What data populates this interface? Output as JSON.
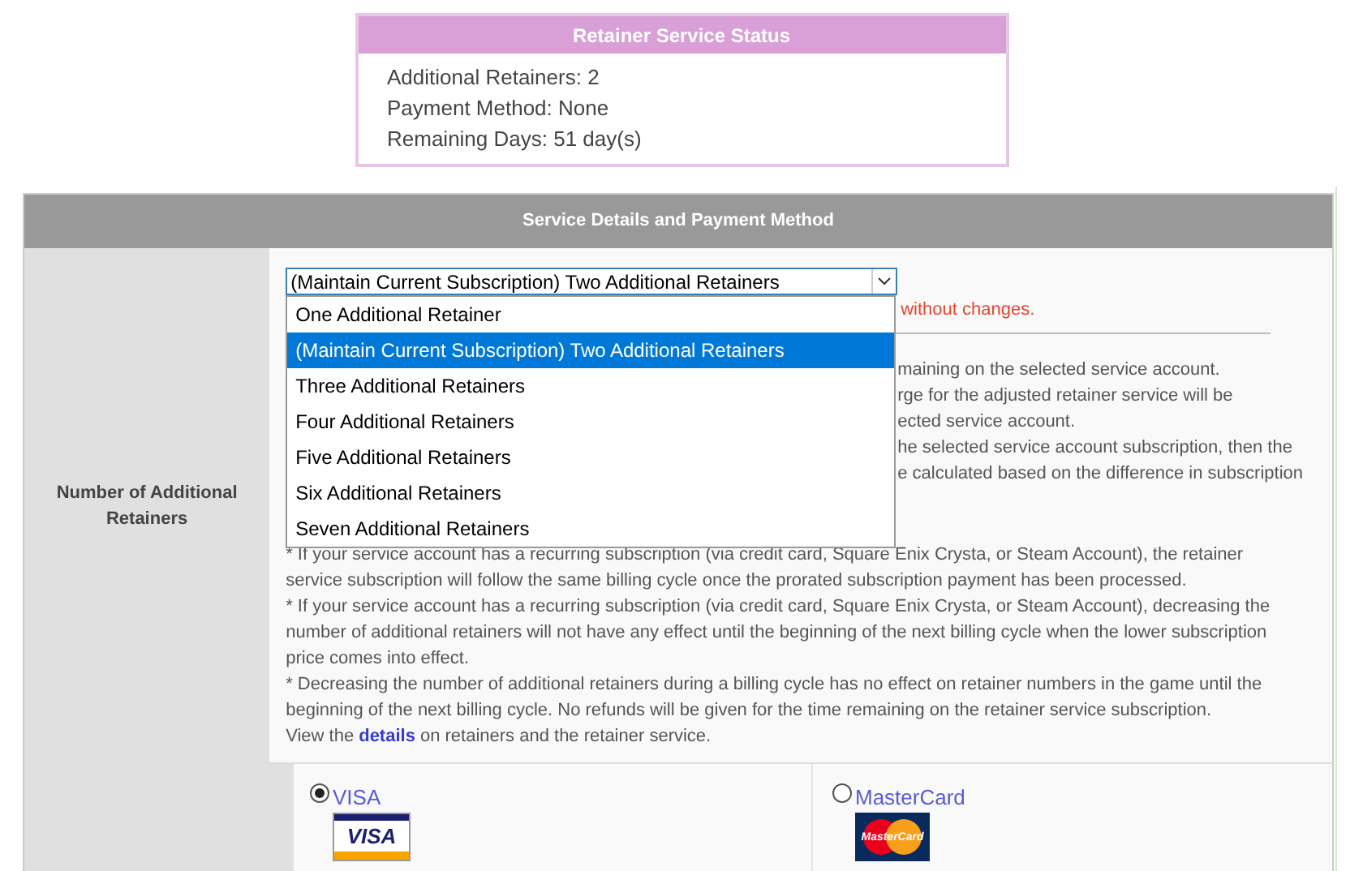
{
  "status": {
    "title": "Retainer Service Status",
    "lines": [
      "Additional Retainers: 2",
      "Payment Method: None",
      "Remaining Days: 51 day(s)"
    ]
  },
  "service": {
    "header": "Service Details and Payment Method",
    "row_label": "Number of Additional Retainers",
    "select": {
      "value": "(Maintain Current Subscription) Two Additional Retainers",
      "expanded": true,
      "options": [
        {
          "label": "One Additional Retainer",
          "selected": false
        },
        {
          "label": "(Maintain Current Subscription) Two Additional Retainers",
          "selected": true
        },
        {
          "label": "Three Additional Retainers",
          "selected": false
        },
        {
          "label": "Four Additional Retainers",
          "selected": false
        },
        {
          "label": "Five Additional Retainers",
          "selected": false
        },
        {
          "label": "Six Additional Retainers",
          "selected": false
        },
        {
          "label": "Seven Additional Retainers",
          "selected": false
        }
      ]
    },
    "notice_fragment": "without changes.",
    "fragments": [
      "maining on the selected service account.",
      "rge for the adjusted retainer service will be",
      "ected service account.",
      "he selected service account subscription, then the",
      "e calculated based on the difference in subscription"
    ],
    "notes": [
      "* If your service account has a recurring subscription (via credit card, Square Enix Crysta, or Steam Account), the retainer service subscription will follow the same billing cycle once the prorated subscription payment has been processed.",
      "* If your service account has a recurring subscription (via credit card, Square Enix Crysta, or Steam Account), decreasing the number of additional retainers will not have any effect until the beginning of the next billing cycle when the lower subscription price comes into effect.",
      "* Decreasing the number of additional retainers during a billing cycle has no effect on retainer numbers in the game until the beginning of the next billing cycle. No refunds will be given for the time remaining on the retainer service subscription."
    ],
    "details_line": {
      "prefix": "View the",
      "link": "details",
      "suffix": "on retainers and the retainer service."
    }
  },
  "payment": {
    "options": [
      {
        "kind": "visa",
        "label": "VISA",
        "logo": "VISA",
        "selected": true
      },
      {
        "kind": "mastercard",
        "label": "MasterCard",
        "logo": "MasterCard",
        "selected": false
      }
    ]
  }
}
